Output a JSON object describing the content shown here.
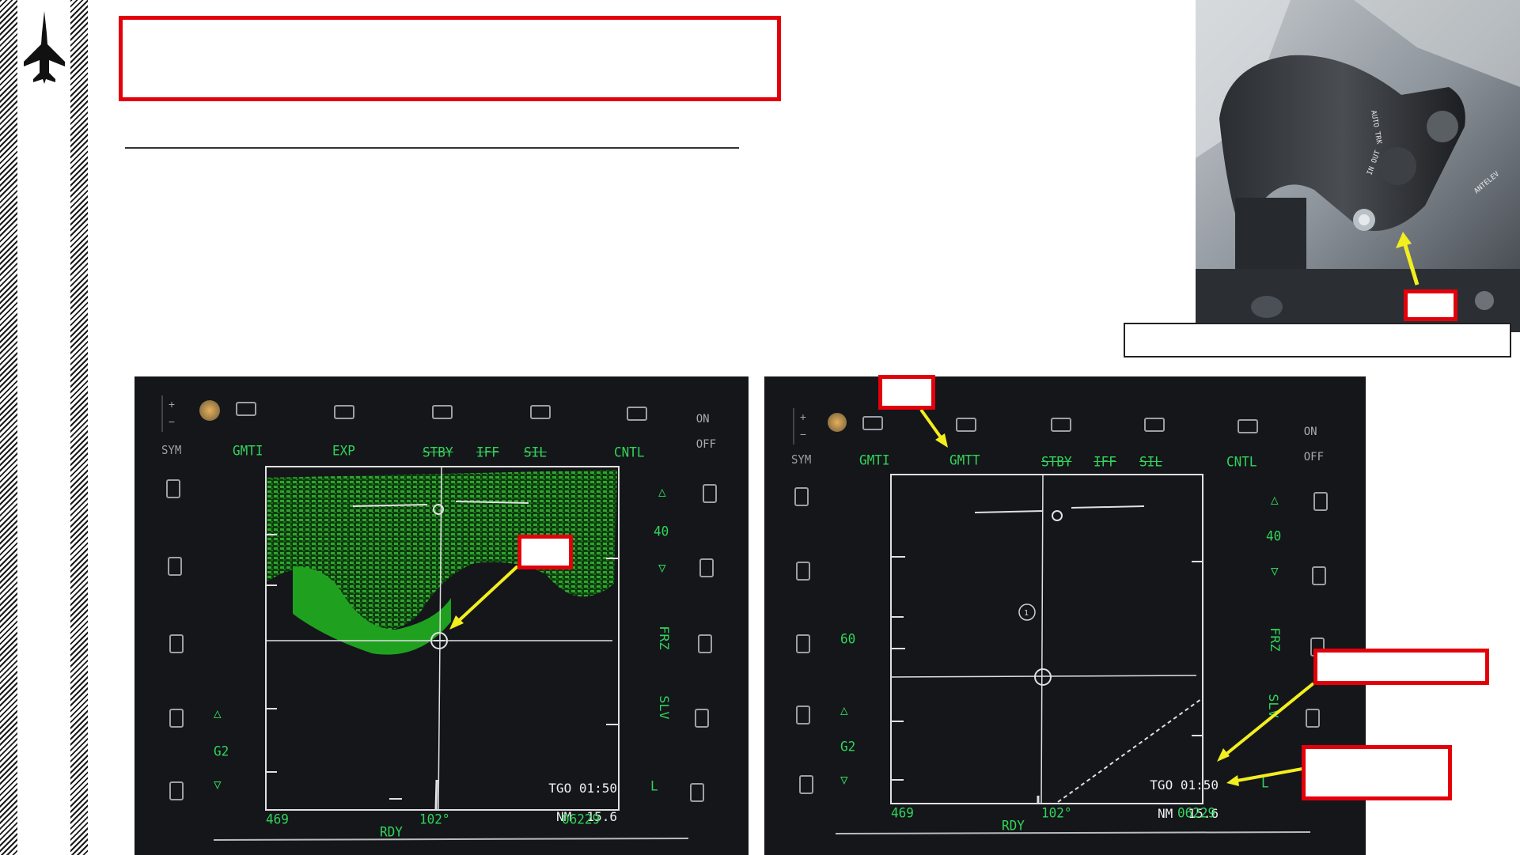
{
  "page": {
    "title_box_text": "",
    "photo_caption_text": ""
  },
  "mfd_left": {
    "top_labels": [
      "GMTI",
      "EXP",
      "STBY",
      "IFF",
      "SIL",
      "CNTL"
    ],
    "sym_label": "SYM",
    "on_off": [
      "ON",
      "OFF"
    ],
    "gain": "G2",
    "range": "40",
    "side_right": [
      "FRZ",
      "SLV",
      "L"
    ],
    "tgo": "TGO 01:50",
    "nm": "NM  15.6",
    "bottom_left": "469",
    "bottom_center": "102°",
    "bottom_right": "06229",
    "status": "RDY",
    "callout_text": ""
  },
  "mfd_right": {
    "top_labels": [
      "GMTT",
      "STBY",
      "IFF",
      "SIL",
      "CNTL"
    ],
    "top_left_label": "GMTI",
    "sym_label": "SYM",
    "on_off": [
      "ON",
      "OFF"
    ],
    "gain": "G2",
    "range": "40",
    "elev": "60",
    "side_right": [
      "FRZ",
      "SLV",
      "L"
    ],
    "target_marker": "1",
    "tgo": "TGO 01:50",
    "nm": "NM  15.6",
    "bottom_left": "469",
    "bottom_center": "102°",
    "bottom_right": "06229",
    "status": "RDY",
    "callout_mode_text": "",
    "callout_tgo_text": "",
    "callout_nm_text": ""
  },
  "photo": {
    "callout_text": "",
    "stick_labels": [
      "AUTO TRK",
      "IN OUT",
      "ANTELEV"
    ]
  },
  "colors": {
    "accent_red": "#e3000b",
    "arrow_yellow": "#f3ee1e",
    "radar_green": "#31d45a",
    "terrain_green": "#1f8f1f"
  }
}
